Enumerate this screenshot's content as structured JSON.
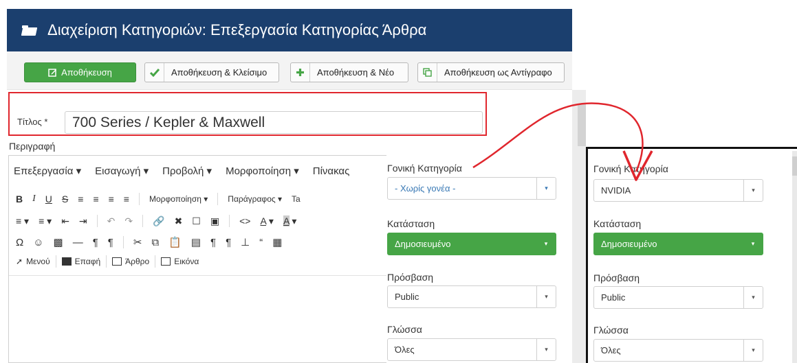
{
  "header": {
    "title": "Διαχείριση Κατηγοριών: Επεξεργασία Κατηγορίας Άρθρα"
  },
  "toolbar": {
    "save": "Αποθήκευση",
    "save_close": "Αποθήκευση & Κλείσιμο",
    "save_new": "Αποθήκευση & Νέο",
    "save_copy": "Αποθήκευση ως Αντίγραφο"
  },
  "form": {
    "title_label": "Τίτλος *",
    "title_value": "700 Series / Kepler & Maxwell",
    "description_label": "Περιγραφή"
  },
  "editor": {
    "menus": [
      "Επεξεργασία ▾",
      "Εισαγωγή ▾",
      "Προβολή ▾",
      "Μορφοποίηση ▾",
      "Πίνακας"
    ],
    "format_dropdown": "Μορφοποίηση ▾",
    "paragraph_dropdown": "Παράγραφος ▾",
    "insert_buttons": [
      "Μενού",
      "Επαφή",
      "Άρθρο",
      "Εικόνα"
    ]
  },
  "before_panel": {
    "parent_label": "Γονική Κατηγορία",
    "parent_value": "- Χωρίς γονέα -",
    "status_label": "Κατάσταση",
    "status_value": "Δημοσιευμένο",
    "access_label": "Πρόσβαση",
    "access_value": "Public",
    "language_label": "Γλώσσα",
    "language_value": "Όλες"
  },
  "after_panel": {
    "parent_label": "Γονική Κατηγορία",
    "parent_value": "NVIDIA",
    "status_label": "Κατάσταση",
    "status_value": "Δημοσιευμένο",
    "access_label": "Πρόσβαση",
    "access_value": "Public",
    "language_label": "Γλώσσα",
    "language_value": "Όλες"
  },
  "colors": {
    "header_bg": "#1b3f6e",
    "success": "#46a546",
    "annotation_red": "#e0262d",
    "link_blue": "#3878b4"
  }
}
